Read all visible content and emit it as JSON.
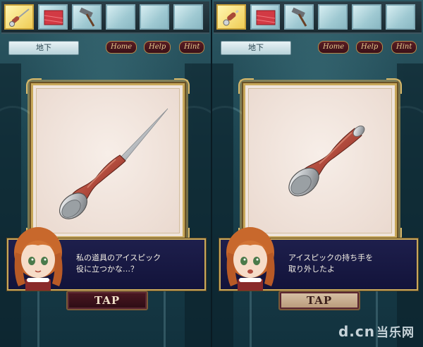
{
  "toolbar": {
    "location": "地下",
    "home_label": "Home",
    "help_label": "Help",
    "hint_label": "Hint"
  },
  "inventory": {
    "slots": [
      {
        "item": "ice-pick",
        "icon": "ice-pick-icon",
        "selected": true
      },
      {
        "item": "red-cloth",
        "icon": "red-cloth-icon",
        "selected": false
      },
      {
        "item": "hammer",
        "icon": "hammer-icon",
        "selected": false
      },
      {
        "item": "",
        "icon": "",
        "selected": false
      },
      {
        "item": "",
        "icon": "",
        "selected": false
      },
      {
        "item": "",
        "icon": "",
        "selected": false
      }
    ]
  },
  "left_screen": {
    "item_name": "ice pick",
    "dialog_line1": "私の道具のアイスピック",
    "dialog_line2": "役に立つかな…？",
    "tap_label": "TAP"
  },
  "right_screen": {
    "item_name": "ice pick handle",
    "dialog_line1": "アイスピックの持ち手を",
    "dialog_line2": "取り外したよ",
    "tap_label": "TAP"
  },
  "watermark": {
    "text": "d.cn",
    "cn_text": "当乐网"
  },
  "colors": {
    "frame_gold": "#c8a85a",
    "dialog_bg": "#1e1f4c",
    "handle_wood": "#b04a3c"
  }
}
